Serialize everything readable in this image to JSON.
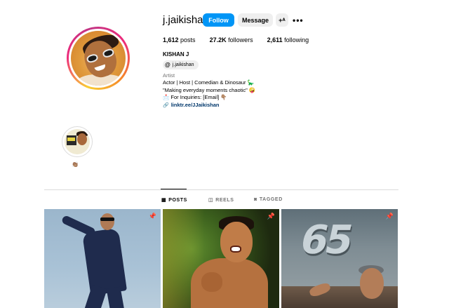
{
  "profile": {
    "username": "j.jaikishan",
    "follow_label": "Follow",
    "message_label": "Message",
    "suggest_icon": "add-person-icon",
    "more_icon": "more-horizontal-icon",
    "stats": {
      "posts_count": "1,612",
      "posts_label": "posts",
      "followers_count": "27.2K",
      "followers_label": "followers",
      "following_count": "2,611",
      "following_label": "following"
    },
    "full_name": "KISHAN J",
    "threads_handle": "j.jaikishan",
    "category": "Artist",
    "bio_lines": [
      "Actor | Host | Comedian & Dinosaur 🦕",
      "\"Making everyday moments chaotic\" 🤪",
      "📩 For Inquiries: [Email] 👇🏽"
    ],
    "link": "linktr.ee/JJaikishan"
  },
  "highlights": [
    {
      "label": "👏🏽"
    }
  ],
  "tabs": [
    {
      "label": "POSTS",
      "icon": "grid-icon",
      "active": true
    },
    {
      "label": "REELS",
      "icon": "reels-icon",
      "active": false
    },
    {
      "label": "TAGGED",
      "icon": "tagged-icon",
      "active": false
    }
  ],
  "posts": [
    {
      "pinned": true
    },
    {
      "pinned": true
    },
    {
      "pinned": true,
      "overlay_text": "65"
    }
  ],
  "colors": {
    "follow_button": "#0095f6",
    "secondary_button": "#efefef",
    "link": "#00376b",
    "muted_text": "#737373"
  }
}
